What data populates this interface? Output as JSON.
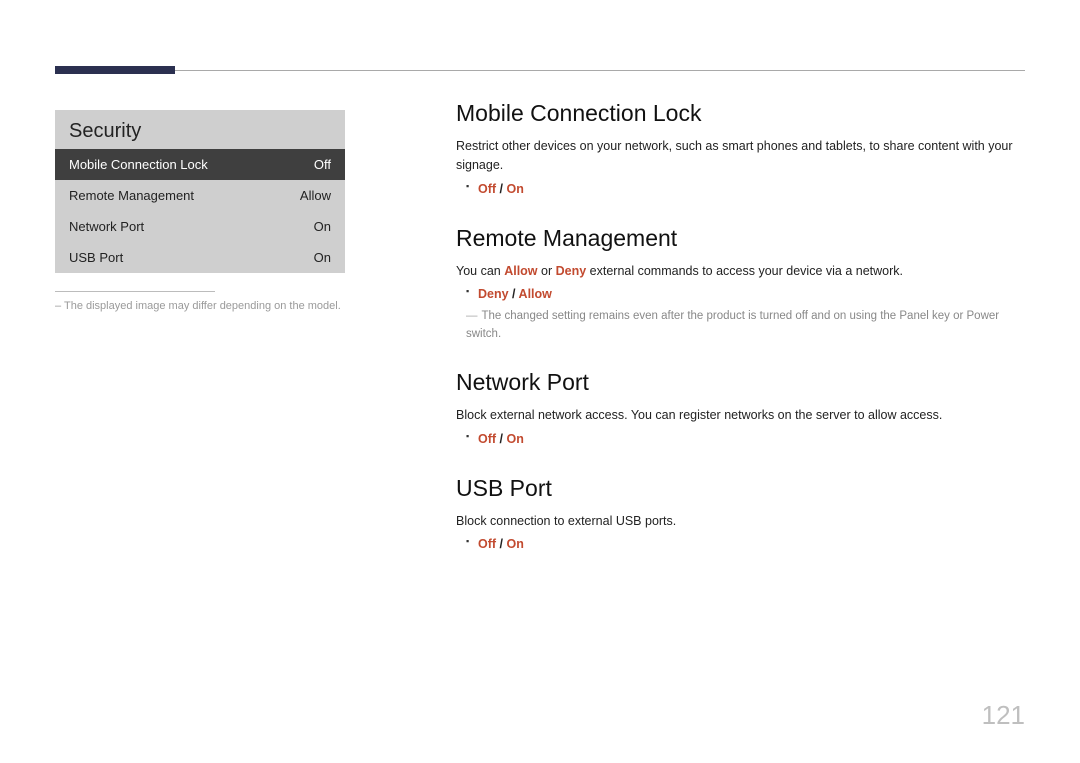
{
  "menu": {
    "title": "Security",
    "items": [
      {
        "label": "Mobile Connection Lock",
        "value": "Off",
        "selected": true
      },
      {
        "label": "Remote Management",
        "value": "Allow",
        "selected": false
      },
      {
        "label": "Network Port",
        "value": "On",
        "selected": false
      },
      {
        "label": "USB Port",
        "value": "On",
        "selected": false
      }
    ],
    "note": "The displayed image may differ depending on the model."
  },
  "sections": {
    "mcl": {
      "heading": "Mobile Connection Lock",
      "desc": "Restrict other devices on your network, such as smart phones and tablets, to share content with your signage.",
      "opt1": "Off",
      "sep": " / ",
      "opt2": "On"
    },
    "rm": {
      "heading": "Remote Management",
      "desc_pre": "You can ",
      "allow": "Allow",
      "desc_mid": " or ",
      "deny": "Deny",
      "desc_post": " external commands to access your device via a network.",
      "opt1": "Deny",
      "sep": " / ",
      "opt2": "Allow",
      "note": "The changed setting remains even after the product is turned off and on using the Panel key or Power switch."
    },
    "np": {
      "heading": "Network Port",
      "desc": "Block external network access. You can register networks on the server to allow access.",
      "opt1": "Off",
      "sep": " / ",
      "opt2": "On"
    },
    "usb": {
      "heading": "USB Port",
      "desc": "Block connection to external USB ports.",
      "opt1": "Off",
      "sep": " / ",
      "opt2": "On"
    }
  },
  "page": "121",
  "dash_prefix": "– "
}
